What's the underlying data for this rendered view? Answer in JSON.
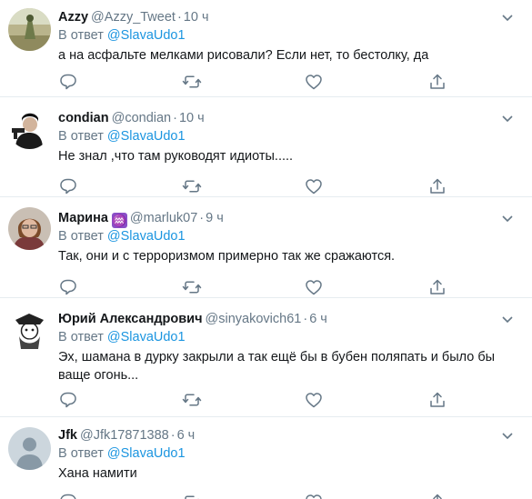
{
  "reply_prefix": "В ответ",
  "tweets": [
    {
      "name": "Azzy",
      "handle": "@Azzy_Tweet",
      "time": "10 ч",
      "reply_to": "@SlavaUdo1",
      "text": "а на асфальте мелками рисовали? Если нет, то бестолку, да"
    },
    {
      "name": "condian",
      "handle": "@condian",
      "time": "10 ч",
      "reply_to": "@SlavaUdo1",
      "text": "Не знал ,что там руководят идиоты....."
    },
    {
      "name": "Марина",
      "badge": "♒",
      "handle": "@marluk07",
      "time": "9 ч",
      "reply_to": "@SlavaUdo1",
      "text": "Так, они и с терроризмом примерно так же сражаются."
    },
    {
      "name": "Юрий Александрович",
      "handle": "@sinyakovich61",
      "time": "6 ч",
      "reply_to": "@SlavaUdo1",
      "text": "Эх, шамана в дурку закрыли а так ещё бы в бубен поляпать и было бы ваще огонь..."
    },
    {
      "name": "Jfk",
      "handle": "@Jfk17871388",
      "time": "6 ч",
      "reply_to": "@SlavaUdo1",
      "text": "Хана намити"
    }
  ],
  "colors": {
    "text": "#14171a",
    "secondary": "#657786",
    "link": "#1b95e0",
    "divider": "#e6ecf0",
    "badge": "#8a4fc7"
  },
  "icons": {
    "actions": [
      "reply-icon",
      "retweet-icon",
      "like-icon",
      "share-icon"
    ],
    "menu": "chevron-down-icon"
  }
}
